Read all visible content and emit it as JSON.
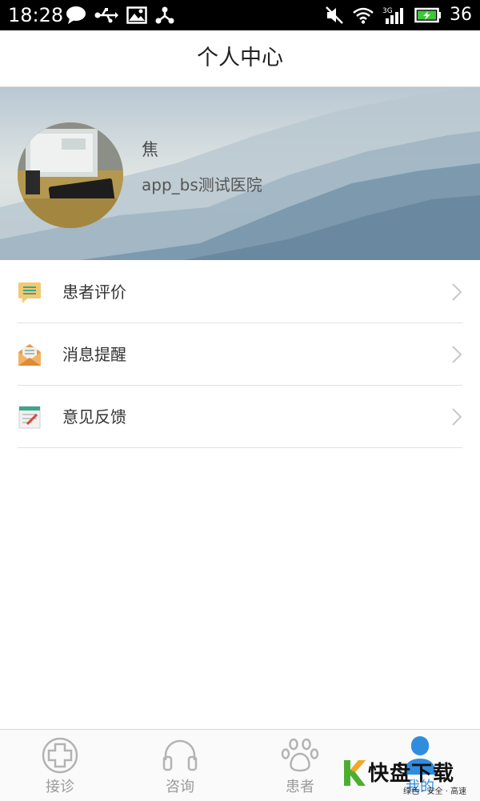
{
  "status_bar": {
    "time": "18:28",
    "battery_level": "36",
    "network": "3G",
    "icons": [
      "chat-icon",
      "usb-icon",
      "image-icon",
      "share-icon",
      "mute-icon",
      "wifi-icon",
      "signal-icon",
      "battery-charging-icon"
    ]
  },
  "header": {
    "title": "个人中心"
  },
  "profile": {
    "name": "焦",
    "organization": "app_bs测试医院"
  },
  "menu": {
    "items": [
      {
        "label": "患者评价",
        "icon": "comment-list-icon"
      },
      {
        "label": "消息提醒",
        "icon": "envelope-icon"
      },
      {
        "label": "意见反馈",
        "icon": "notepad-icon"
      }
    ]
  },
  "tabs": [
    {
      "label": "接诊",
      "icon": "plus-circle-icon"
    },
    {
      "label": "咨询",
      "icon": "headset-icon"
    },
    {
      "label": "患者",
      "icon": "paw-icon"
    },
    {
      "label": "我的",
      "icon": "person-icon",
      "active": true
    }
  ],
  "watermark": {
    "text_main": "快盘下载",
    "text_sub": "绿色 · 安全 · 高速"
  },
  "colors": {
    "accent": "#2f8de0",
    "status_bar_bg": "#000000",
    "tab_inactive": "#9a9a9a",
    "banner_mountain": "#6d8ca4"
  }
}
